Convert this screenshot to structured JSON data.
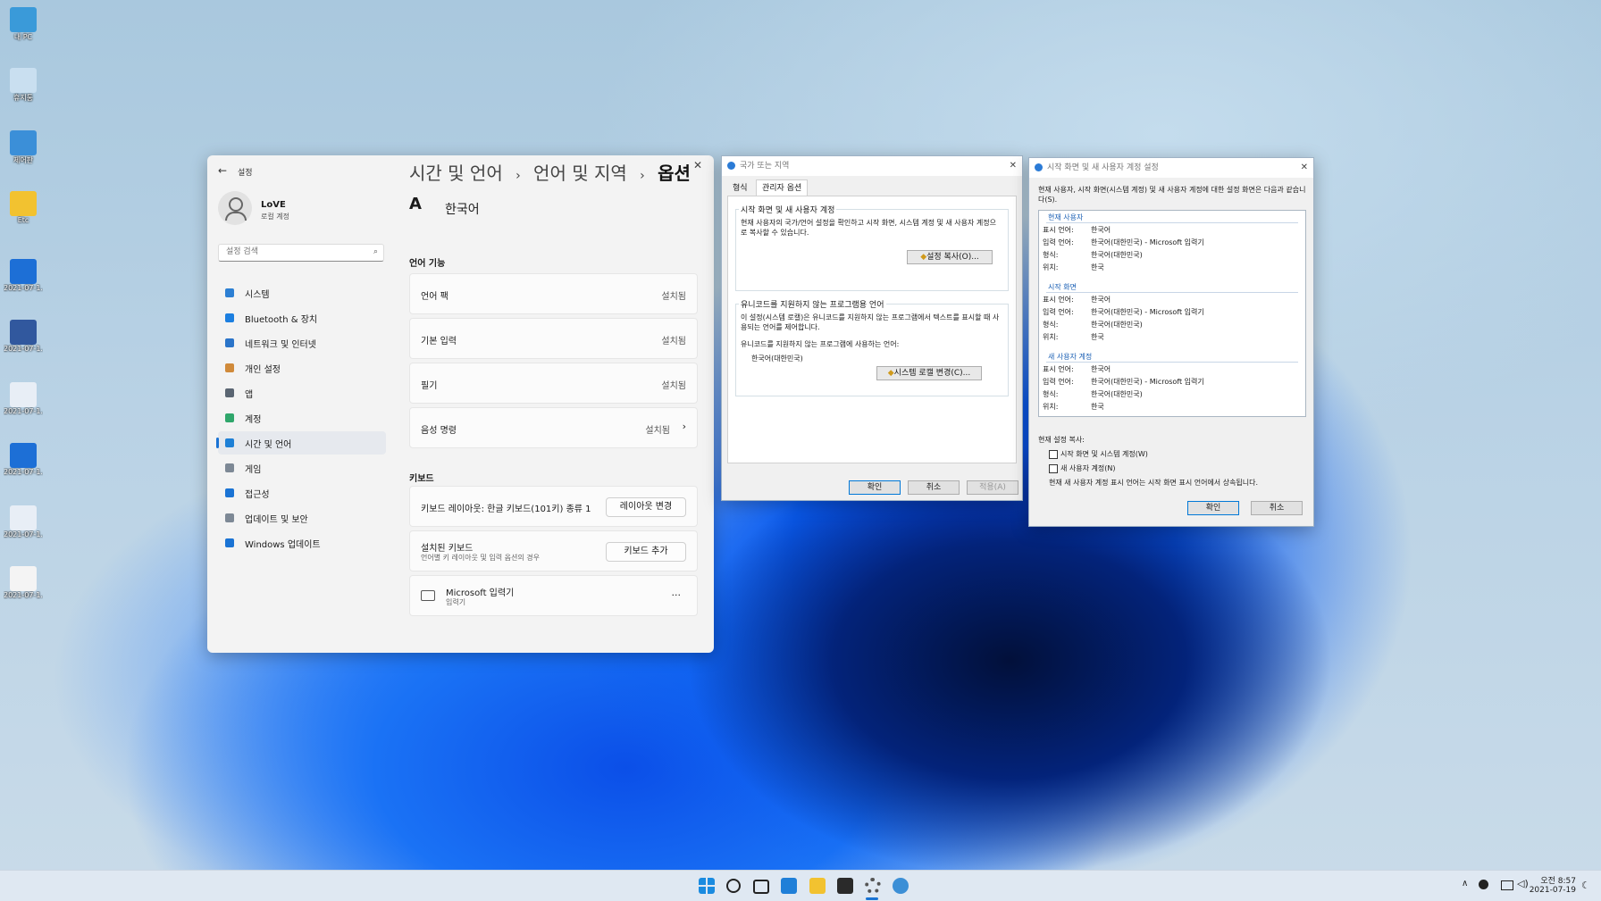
{
  "desktop": {
    "icons": [
      {
        "label": "내 PC",
        "color": "#3a9ad9"
      },
      {
        "label": "휴지통",
        "color": "#c9dff0"
      },
      {
        "label": "제어판",
        "color": "#3b8fd8"
      },
      {
        "label": "Etc",
        "color": "#f2c230"
      },
      {
        "label": "2021-07-1...",
        "color": "#1d6fd6"
      },
      {
        "label": "2021-07-1...",
        "color": "#31589e"
      },
      {
        "label": "2021-07-1...",
        "color": "#e8eef6"
      },
      {
        "label": "2021-07-1...",
        "color": "#1d6fd6"
      },
      {
        "label": "2021-07-1...",
        "color": "#e8eef6"
      },
      {
        "label": "2021-07-1...",
        "color": "#f4f4f4"
      }
    ]
  },
  "settings": {
    "app_title": "설정",
    "back_icon": "back-arrow-icon",
    "user": {
      "name": "LoVE",
      "account": "로컬 계정"
    },
    "search_placeholder": "설정 검색",
    "nav": [
      {
        "label": "시스템",
        "icon": "monitor-icon",
        "color": "#2c7fd3"
      },
      {
        "label": "Bluetooth & 장치",
        "icon": "bluetooth-icon",
        "color": "#1c7fe0"
      },
      {
        "label": "네트워크 및 인터넷",
        "icon": "wifi-icon",
        "color": "#2a74c9"
      },
      {
        "label": "개인 설정",
        "icon": "brush-icon",
        "color": "#d08a3a"
      },
      {
        "label": "앱",
        "icon": "apps-icon",
        "color": "#5a6572"
      },
      {
        "label": "계정",
        "icon": "person-icon",
        "color": "#2fa66b"
      },
      {
        "label": "시간 및 언어",
        "icon": "globe-icon",
        "color": "#1e80d6"
      },
      {
        "label": "게임",
        "icon": "gamepad-icon",
        "color": "#7d8895"
      },
      {
        "label": "접근성",
        "icon": "accessibility-icon",
        "color": "#1a73d4"
      },
      {
        "label": "업데이트 및 보안",
        "icon": "shield-icon",
        "color": "#7d8895"
      },
      {
        "label": "Windows 업데이트",
        "icon": "update-icon",
        "color": "#1a73d4"
      }
    ],
    "selected_nav": "시간 및 언어",
    "breadcrumb": [
      "시간 및 언어",
      "언어 및 지역",
      "옵션"
    ],
    "language_name": "한국어",
    "section_language": "언어 기능",
    "features": [
      {
        "label": "언어 팩",
        "status": "설치됨"
      },
      {
        "label": "기본 입력",
        "status": "설치됨"
      },
      {
        "label": "필기",
        "status": "설치됨"
      },
      {
        "label": "음성 명령",
        "status": "설치됨"
      }
    ],
    "section_keyboard": "키보드",
    "keyboard_layout_label": "키보드 레이아웃: 한글 키보드(101키) 종류 1",
    "change_layout_button": "레이아웃 변경",
    "installed_keyboards_title": "설치된 키보드",
    "installed_keyboards_sub": "언어별 키 레이아웃 및 입력 옵션의 경우",
    "add_keyboard_button": "키보드 추가",
    "ime_name": "Microsoft 입력기",
    "ime_sub": "입력기",
    "more": "..."
  },
  "region": {
    "title": "국가 또는 지역",
    "tabs": [
      "형식",
      "관리자 옵션"
    ],
    "active_tab": "관리자 옵션",
    "group1_title": "시작 화면 및 새 사용자 계정",
    "group1_text": "현재 사용자의 국가/언어 설정을 확인하고 시작 화면, 시스템 계정 및 새 사용자 계정으로 복사할 수 있습니다.",
    "copy_settings_button": "설정 복사(O)...",
    "group2_title": "유니코드를 지원하지 않는 프로그램용 언어",
    "group2_text": "이 설정(시스템 로캘)은 유니코드를 지원하지 않는 프로그램에서 텍스트를 표시할 때 사용되는 언어를 제어합니다.",
    "current_lang_label": "유니코드를 지원하지 않는 프로그램에 사용하는 언어:",
    "current_lang": "한국어(대한민국)",
    "change_locale_button": "시스템 로캘 변경(C)...",
    "ok": "확인",
    "cancel": "취소",
    "apply": "적용(A)"
  },
  "welcome": {
    "title": "시작 화면 및 새 사용자 계정 설정",
    "intro": "현재 사용자, 시작 화면(시스템 계정) 및 새 사용자 계정에 대한 설정 화면은 다음과 같습니다(S).",
    "sections": [
      {
        "name": "현재 사용자",
        "rows": [
          {
            "k": "표시 언어:",
            "v": "한국어"
          },
          {
            "k": "입력 언어:",
            "v": "한국어(대한민국) - Microsoft 입력기"
          },
          {
            "k": "형식:",
            "v": "한국어(대한민국)"
          },
          {
            "k": "위치:",
            "v": "한국"
          }
        ]
      },
      {
        "name": "시작 화면",
        "rows": [
          {
            "k": "표시 언어:",
            "v": "한국어"
          },
          {
            "k": "입력 언어:",
            "v": "한국어(대한민국) - Microsoft 입력기"
          },
          {
            "k": "형식:",
            "v": "한국어(대한민국)"
          },
          {
            "k": "위치:",
            "v": "한국"
          }
        ]
      },
      {
        "name": "새 사용자 계정",
        "rows": [
          {
            "k": "표시 언어:",
            "v": "한국어"
          },
          {
            "k": "입력 언어:",
            "v": "한국어(대한민국) - Microsoft 입력기"
          },
          {
            "k": "형식:",
            "v": "한국어(대한민국)"
          },
          {
            "k": "위치:",
            "v": "한국"
          }
        ]
      }
    ],
    "copy_label": "현재 설정 복사:",
    "check1": "시작 화면 및 시스템 계정(W)",
    "check2": "새 사용자 계정(N)",
    "note": "현재 새 사용자 계정 표시 언어는 시작 화면 표시 언어에서 상속됩니다.",
    "ok": "확인",
    "cancel": "취소"
  },
  "taskbar": {
    "icons": [
      "windows-start-icon",
      "search-icon",
      "task-view-icon",
      "widgets-icon",
      "file-explorer-icon",
      "store-icon",
      "settings-gear-icon",
      "region-globe-icon"
    ],
    "clock_time": "오전 8:57",
    "clock_date": "2021-07-19"
  }
}
